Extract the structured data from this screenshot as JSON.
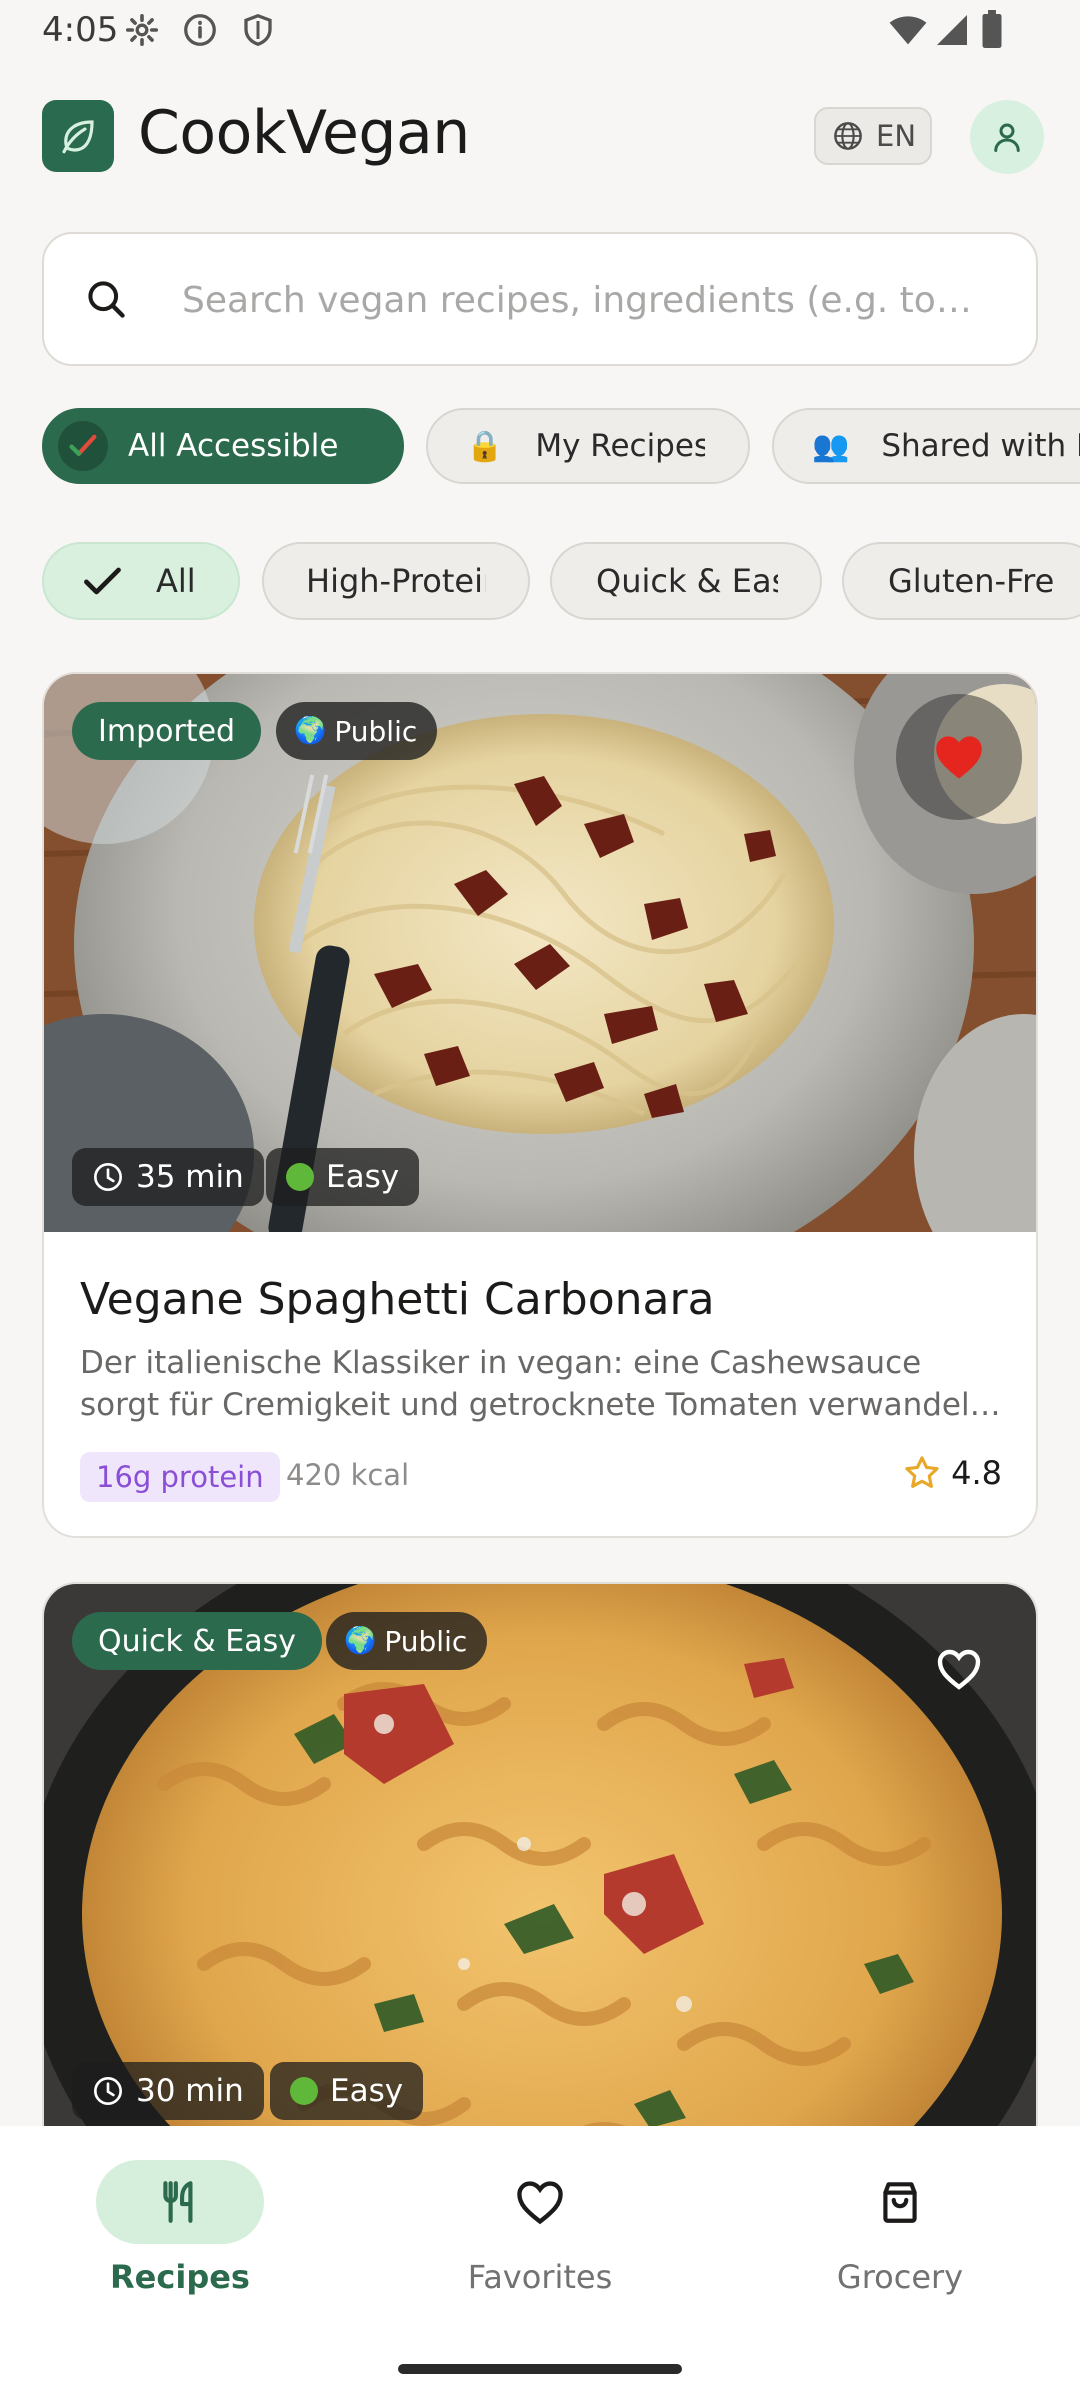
{
  "status_bar": {
    "time": "4:05"
  },
  "header": {
    "app_title": "CookVegan",
    "language": "EN"
  },
  "search": {
    "placeholder": "Search vegan recipes, ingredients (e.g. to…"
  },
  "access_chips": [
    {
      "label": "All Accessible",
      "active": true
    },
    {
      "label": "My Recipes",
      "icon": "lock-icon"
    },
    {
      "label": "Shared with Me",
      "icon": "people-icon"
    }
  ],
  "filter_chips": [
    {
      "label": "All",
      "active": true
    },
    {
      "label": "High-Protein"
    },
    {
      "label": "Quick & Easy"
    },
    {
      "label": "Gluten-Free"
    }
  ],
  "recipes": [
    {
      "tag": "Imported",
      "visibility": "Public",
      "time": "35 min",
      "difficulty": "Easy",
      "favorited": true,
      "title": "Vegane Spaghetti Carbonara",
      "description": "Der italienische Klassiker in vegan: eine Cashewsauce sorgt für Cremigkeit und getrocknete Tomaten verwandeln das Gericht in ein Fest für die Sinne.",
      "protein": "16g protein",
      "kcal": "420 kcal",
      "rating": "4.8"
    },
    {
      "tag": "Quick & Easy",
      "visibility": "Public",
      "time": "30 min",
      "difficulty": "Easy",
      "favorited": false
    }
  ],
  "bottom_nav": [
    {
      "label": "Recipes",
      "icon": "fork-knife-icon",
      "active": true
    },
    {
      "label": "Favorites",
      "icon": "heart-icon"
    },
    {
      "label": "Grocery",
      "icon": "shopping-bag-icon"
    }
  ],
  "colors": {
    "brand_green": "#2c6a4e",
    "light_green": "#d9f0df",
    "favorite_red": "#e5261f",
    "protein_purple": "#8a4fd6"
  }
}
